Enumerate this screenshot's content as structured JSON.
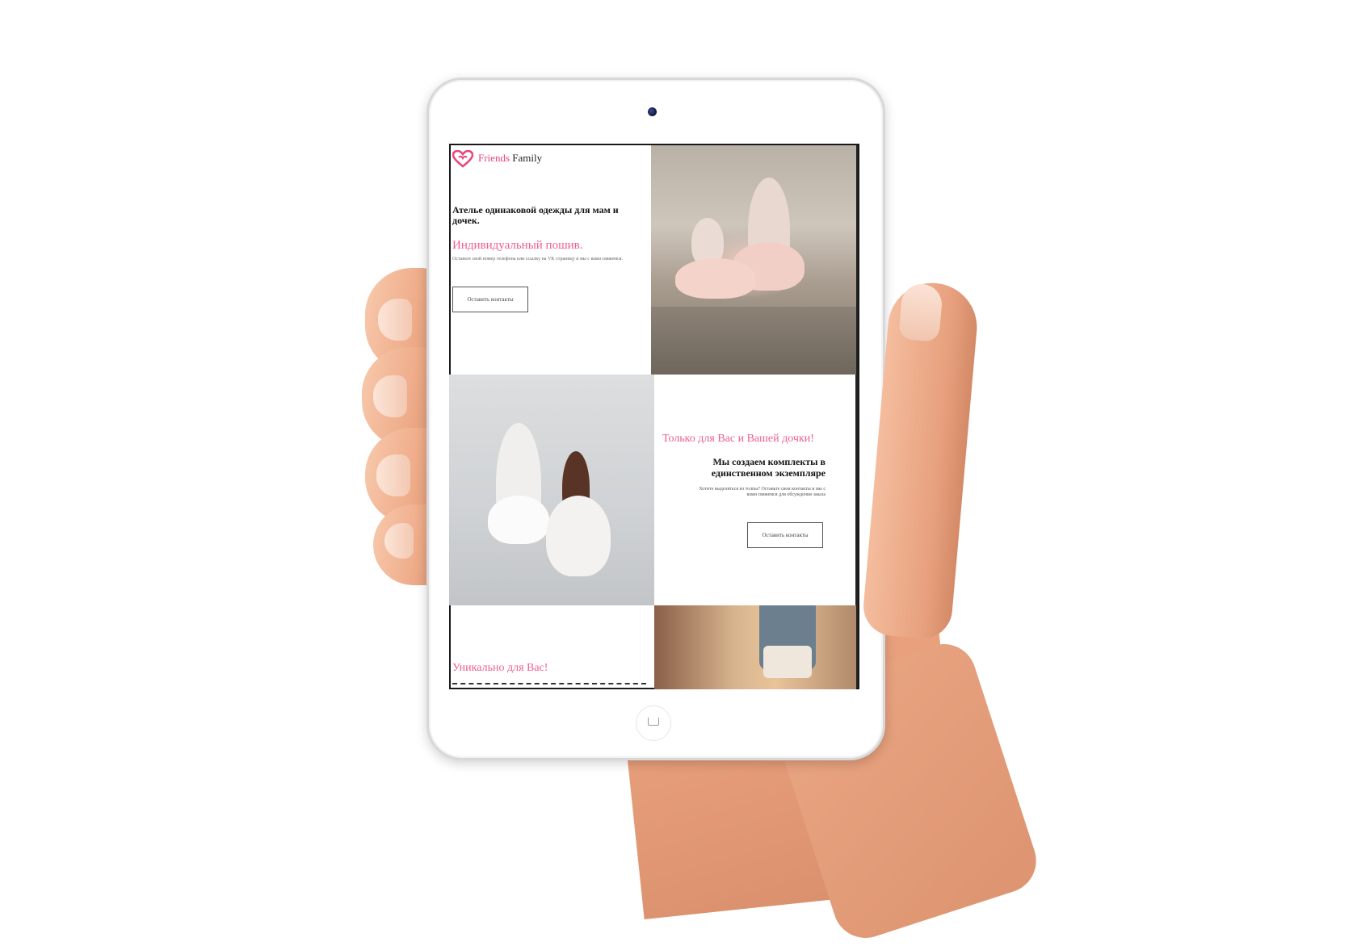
{
  "site": {
    "logo_word_1": "Friends",
    "logo_word_2": "Family",
    "logo_icon": "heart-icon"
  },
  "hero": {
    "title": "Ателье одинаковой одежды для мам и дочек.",
    "subtitle": "Индивидуальный пошив.",
    "note": "Оставьте свой номер телефона или ссылку на VK страницу и мы с вами свяжемся.",
    "button_label": "Оставить контакты"
  },
  "section_two": {
    "title": "Только для Вас и Вашей дочки!",
    "heading": "Мы создаем комплекты в единственном экземпляре",
    "note": "Хотите выделяться из толпы? Оставьте свои контакты и мы с вами свяжемся для обсуждения заказа",
    "button_label": "Оставить контакты"
  },
  "section_three": {
    "title": "Уникально для Вас!"
  },
  "colors": {
    "accent": "#ef5d8f",
    "logo_pink": "#e8457f",
    "text_dark": "#111111"
  }
}
